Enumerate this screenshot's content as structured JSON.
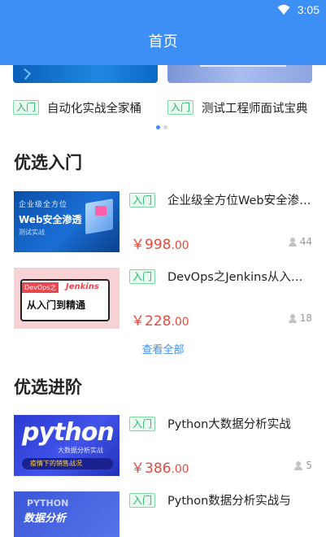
{
  "status_bar": {
    "time": "3:05",
    "wifi_icon": "wifi-icon"
  },
  "app_bar": {
    "title": "首页"
  },
  "carousel": {
    "items": [
      {
        "tag": "入门",
        "title": "自动化实战全家桶"
      },
      {
        "tag": "入门",
        "title": "测试工程师面试宝典"
      }
    ],
    "active_index": 0,
    "count": 2
  },
  "sections": {
    "beginner": {
      "title": "优选入门",
      "courses": [
        {
          "tag": "入门",
          "title": "企业级全方位Web安全渗透测试实战",
          "price_main": "￥998",
          "price_cents": ".00",
          "learners": "44",
          "thumb": {
            "line1": "企业级全方位",
            "line2": "Web安全渗透",
            "line3": "测试实战"
          }
        },
        {
          "tag": "入门",
          "title": "DevOps之Jenkins从入门到精通",
          "price_main": "￥228",
          "price_cents": ".00",
          "learners": "18",
          "thumb": {
            "pill": "DevOps之",
            "brand": "Jenkins",
            "big": "从入门到精通"
          }
        }
      ],
      "view_all": "查看全部"
    },
    "advanced": {
      "title": "优选进阶",
      "courses": [
        {
          "tag": "入门",
          "title": "Python大数据分析实战",
          "price_main": "￥386",
          "price_cents": ".00",
          "learners": "5",
          "thumb": {
            "big": "python",
            "sub": "大数据分析实战",
            "band": "疫情下的销售战况"
          }
        },
        {
          "tag": "入门",
          "title": "Python数据分析实战与",
          "thumb": {
            "top": "PYTHON",
            "big": "数据分析"
          }
        }
      ]
    }
  },
  "colors": {
    "primary": "#3d8ef5",
    "price": "#e04b3e",
    "tag_green": "#2db36b"
  }
}
